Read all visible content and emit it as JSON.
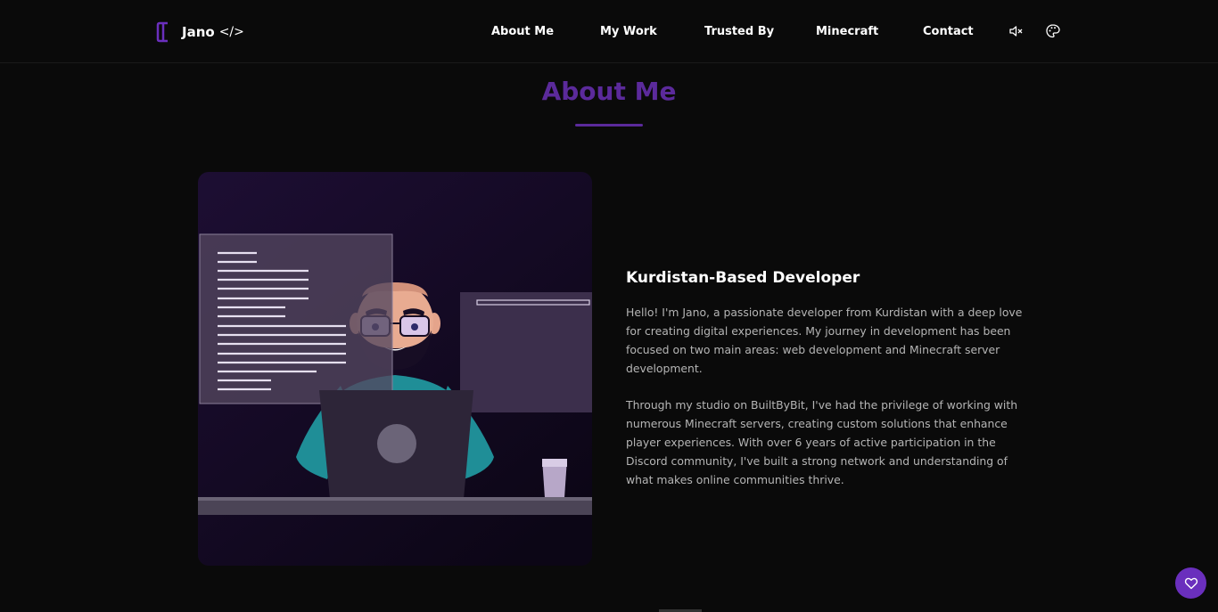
{
  "brand": {
    "name": "Jano",
    "code_tag": "</>"
  },
  "nav": {
    "links": [
      {
        "label": "About Me"
      },
      {
        "label": "My Work"
      },
      {
        "label": "Trusted By"
      },
      {
        "label": "Minecraft"
      },
      {
        "label": "Contact"
      }
    ],
    "icons": [
      "volume-mute-icon",
      "palette-icon"
    ]
  },
  "section": {
    "title": "About Me"
  },
  "about": {
    "heading": "Kurdistan-Based Developer",
    "paragraphs": [
      "Hello! I'm Jano, a passionate developer from Kurdistan with a deep love for creating digital experiences. My journey in development has been focused on two main areas: web development and Minecraft server development.",
      "Through my studio on BuiltByBit, I've had the privilege of working with numerous Minecraft servers, creating custom solutions that enhance player experiences. With over 6 years of active participation in the Discord community, I've built a strong network and understanding of what makes online communities thrive."
    ]
  },
  "floating": {
    "icon": "heart-icon"
  },
  "colors": {
    "accent": "#5b2a9b",
    "background": "#0a0a0a",
    "button": "#6a2fbd"
  }
}
